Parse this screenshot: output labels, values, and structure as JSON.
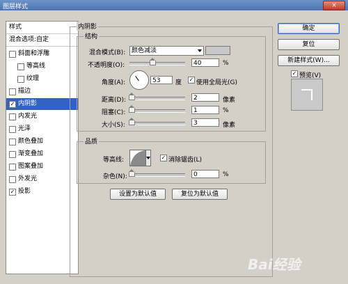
{
  "window": {
    "title": "图层样式",
    "close_glyph": "×"
  },
  "sidebar": {
    "header": "样式",
    "blend_options": "混合选项:自定",
    "items": [
      {
        "label": "斜面和浮雕",
        "checked": false
      },
      {
        "label": "等高线",
        "checked": false
      },
      {
        "label": "纹理",
        "checked": false
      },
      {
        "label": "描边",
        "checked": false
      },
      {
        "label": "内阴影",
        "checked": true
      },
      {
        "label": "内发光",
        "checked": false
      },
      {
        "label": "光泽",
        "checked": false
      },
      {
        "label": "颜色叠加",
        "checked": false
      },
      {
        "label": "渐变叠加",
        "checked": false
      },
      {
        "label": "图案叠加",
        "checked": false
      },
      {
        "label": "外发光",
        "checked": false
      },
      {
        "label": "投影",
        "checked": true
      }
    ],
    "check_glyph": "✓"
  },
  "inner_shadow": {
    "title": "内阴影",
    "structure": {
      "title": "结构",
      "blend_mode_label": "混合模式(B):",
      "blend_mode_value": "颜色减淡",
      "opacity_label": "不透明度(O):",
      "opacity_value": "40",
      "opacity_level": 40,
      "percent": "%",
      "angle_label": "角度(A):",
      "angle_value": "53",
      "angle_unit": "度",
      "global_light_label": "使用全局光(G)",
      "global_light_checked": true,
      "distance_label": "距离(D):",
      "distance_value": "2",
      "choke_label": "阻塞(C):",
      "choke_value": "1",
      "size_label": "大小(S):",
      "size_value": "3",
      "pixel_unit": "像素"
    },
    "quality": {
      "title": "品质",
      "contour_label": "等高线:",
      "anti_alias_label": "消除锯齿(L)",
      "anti_alias_checked": true,
      "noise_label": "杂色(N):",
      "noise_value": "0",
      "percent": "%"
    },
    "set_default": "设置为默认值",
    "reset_default": "复位为默认值"
  },
  "actions": {
    "ok": "确定",
    "reset": "复位",
    "new_style": "新建样式(W)...",
    "preview_label": "预览(V)",
    "preview_checked": true
  },
  "watermark": "Bai经验"
}
